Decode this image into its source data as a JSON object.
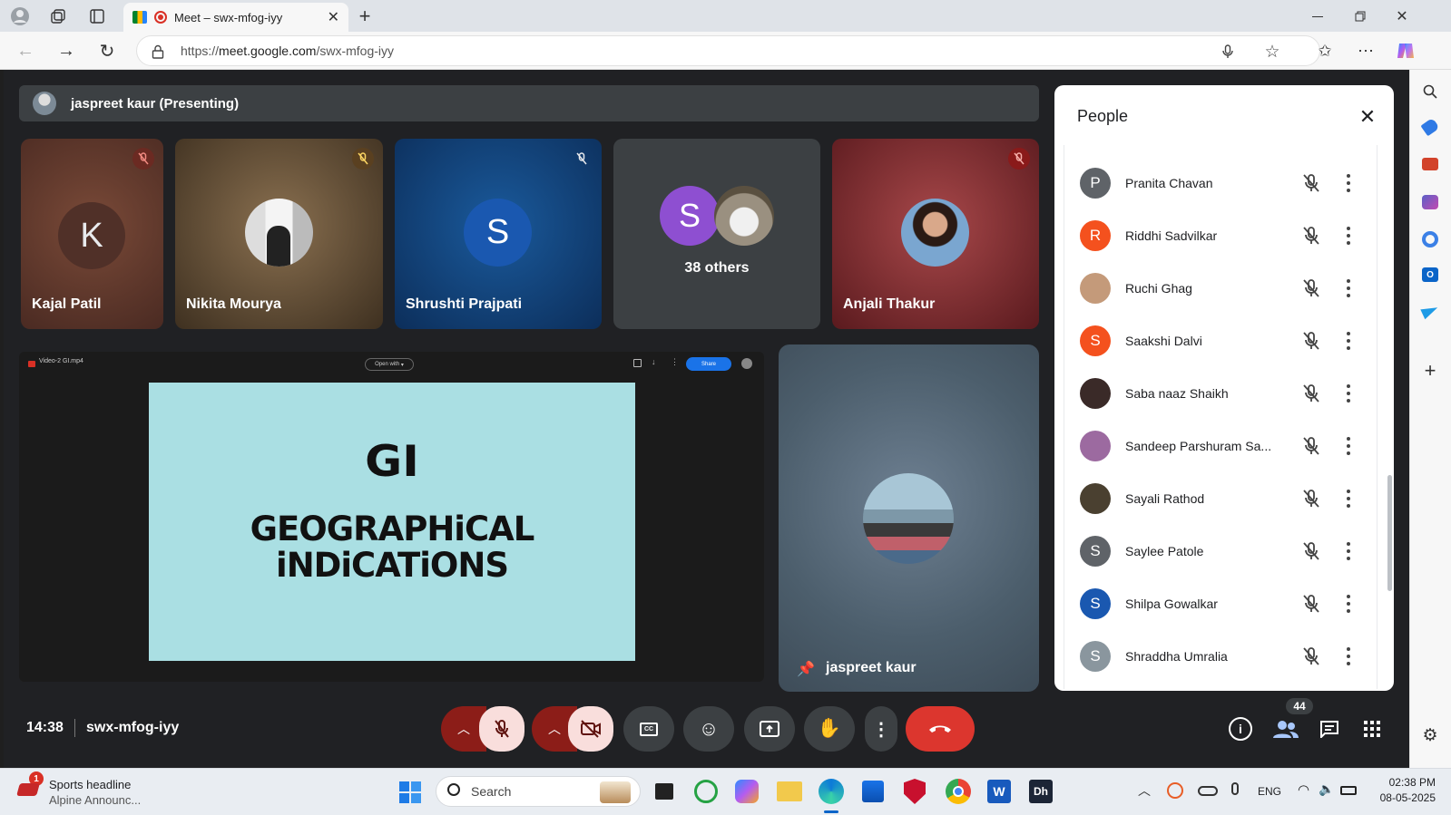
{
  "browser": {
    "tab_title": "Meet – swx-mfog-iyy",
    "url_prefix": "https://",
    "url_host": "meet.google.com",
    "url_path": "/swx-mfog-iyy"
  },
  "meeting": {
    "presenting_label": "jaspreet kaur (Presenting)",
    "time": "14:38",
    "code": "swx-mfog-iyy",
    "people_count": "44"
  },
  "tiles": [
    {
      "name": "Kajal Patil",
      "initial": "K"
    },
    {
      "name": "Nikita Mourya"
    },
    {
      "name": "Shrushti Prajpati",
      "initial": "S"
    },
    {
      "others_label": "38 others",
      "initial": "S"
    },
    {
      "name": "Anjali Thakur"
    }
  ],
  "presentation": {
    "file_name": "Video-2 GI.mp4",
    "open_with": "Open with",
    "share": "Share",
    "slide_title": "GI",
    "slide_line1": "GEOGRAPHiCAL",
    "slide_line2": "iNDiCATiONS"
  },
  "pinned": {
    "name": "jaspreet kaur"
  },
  "people_panel": {
    "title": "People",
    "participants": [
      {
        "name": "Pranita Chavan",
        "initial": "P",
        "color": "#5f6368"
      },
      {
        "name": "Riddhi Sadvilkar",
        "initial": "R",
        "color": "#f4511e"
      },
      {
        "name": "Ruchi Ghag",
        "initial": "",
        "color": "#c49a7a"
      },
      {
        "name": "Saakshi Dalvi",
        "initial": "S",
        "color": "#f4511e"
      },
      {
        "name": "Saba naaz Shaikh",
        "initial": "",
        "color": "#3a2a28"
      },
      {
        "name": "Sandeep Parshuram Sa...",
        "initial": "",
        "color": "#9c6aa0"
      },
      {
        "name": "Sayali Rathod",
        "initial": "",
        "color": "#4a4030"
      },
      {
        "name": "Saylee Patole",
        "initial": "S",
        "color": "#5f6368"
      },
      {
        "name": "Shilpa Gowalkar",
        "initial": "S",
        "color": "#1a58b0"
      },
      {
        "name": "Shraddha Umralia",
        "initial": "S",
        "color": "#8a969e"
      }
    ]
  },
  "taskbar": {
    "news_title": "Sports headline",
    "news_sub": "Alpine Announc...",
    "news_badge": "1",
    "search": "Search",
    "lang": "ENG",
    "clock_time": "02:38 PM",
    "clock_date": "08-05-2025"
  }
}
